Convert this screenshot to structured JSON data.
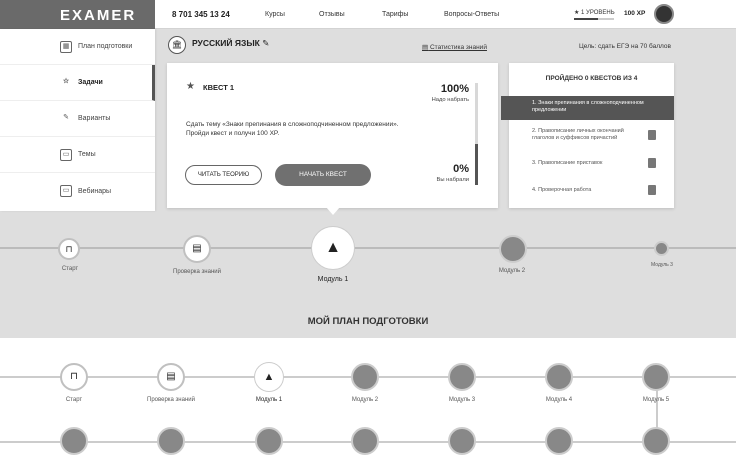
{
  "header": {
    "logo": "EXAMER",
    "phone": "8 701 345 13 24",
    "nav": [
      "Курсы",
      "Отзывы",
      "Тарифы",
      "Вопросы-Ответы"
    ],
    "level": "1 УРОВЕНЬ",
    "xp": "100 XP"
  },
  "sidebar": {
    "items": [
      {
        "label": "План подготовки",
        "icon": "calendar-icon"
      },
      {
        "label": "Задачи",
        "icon": "star-icon"
      },
      {
        "label": "Варианты",
        "icon": "pencil-icon"
      },
      {
        "label": "Темы",
        "icon": "folder-icon"
      },
      {
        "label": "Вебинары",
        "icon": "monitor-icon"
      }
    ]
  },
  "subject": {
    "name": "РУССКИЙ ЯЗЫК",
    "stats_link": "Статистика знаний",
    "goal": "Цель: сдать ЕГЭ на 70 баллов"
  },
  "quest": {
    "title": "КВЕСТ 1",
    "description": "Сдать тему «Знаки препинания в сложноподчиненном предложении». Пройди квест и получи 100 XP.",
    "btn_theory": "ЧИТАТЬ ТЕОРИЮ",
    "btn_start": "НАЧАТЬ КВЕСТ",
    "need_pct": "100%",
    "need_label": "Надо набрать",
    "got_pct": "0%",
    "got_label": "Вы набрали",
    "progress": 0.4
  },
  "quest_list": {
    "header": "ПРОЙДЕНО 0 КВЕСТОВ ИЗ 4",
    "items": [
      "1. Знаки препинания в сложноподчиненном предложении",
      "2. Правописание личных окончаний глаголов и суффиксов причастий",
      "3. Правописание приставок",
      "4. Проверочная работа"
    ]
  },
  "timeline": {
    "nodes": [
      "Старт",
      "Проверка знаний",
      "Модуль 1",
      "Модуль 2",
      "Модуль 3"
    ]
  },
  "plan": {
    "title": "МОЙ ПЛАН ПОДГОТОВКИ",
    "row1": [
      "Старт",
      "Проверка знаний",
      "Модуль 1",
      "Модуль 2",
      "Модуль 3",
      "Модуль 4",
      "Модуль 5"
    ]
  }
}
